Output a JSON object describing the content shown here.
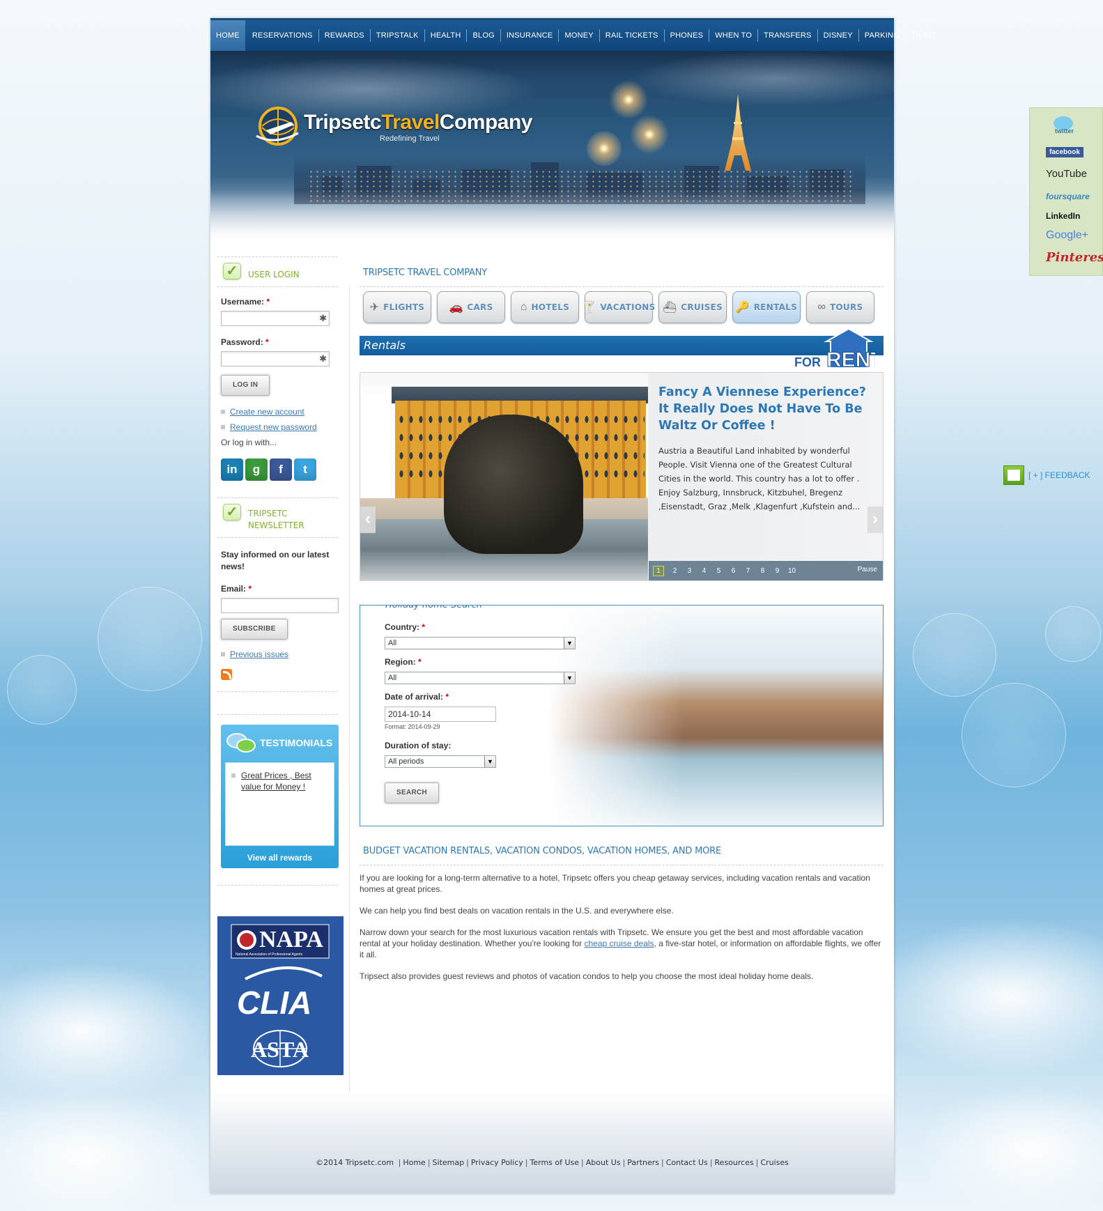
{
  "nav": {
    "items": [
      "HOME",
      "RESERVATIONS",
      "REWARDS",
      "TRIPSTALK",
      "HEALTH",
      "BLOG",
      "INSURANCE",
      "MONEY",
      "RAIL TICKETS",
      "PHONES",
      "WHEN TO",
      "TRANSFERS",
      "DISNEY",
      "PARKING",
      "TICKIT"
    ],
    "active": "HOME"
  },
  "header": {
    "logo_main": "Tripsetc",
    "logo_travel": "Travel",
    "logo_company": "Company",
    "tagline": "Redefining Travel"
  },
  "login": {
    "title": "USER LOGIN",
    "username_label": "Username:",
    "password_label": "Password:",
    "required_mark": "*",
    "login_button": "LOG IN",
    "create_account": "Create new account",
    "request_password": "Request new password",
    "or_login": "Or log in with..."
  },
  "social_login": [
    {
      "name": "linkedin",
      "label": "in",
      "color": "#1b80b5"
    },
    {
      "name": "google",
      "label": "g",
      "color": "#3b9a3c"
    },
    {
      "name": "facebook",
      "label": "f",
      "color": "#3b5998"
    },
    {
      "name": "twitter",
      "label": "t",
      "color": "#3aa5df"
    }
  ],
  "newsletter": {
    "title_line1": "TRIPSETC",
    "title_line2": "NEWSLETTER",
    "lead": "Stay informed on our latest news!",
    "email_label": "Email:",
    "subscribe_button": "SUBSCRIBE",
    "previous_issues": "Previous issues"
  },
  "testimonials": {
    "title": "TESTIMONIALS",
    "item": "Great Prices , Best value for Money !",
    "view_all": "View all rewards"
  },
  "associations": [
    "NAPA",
    "National Association of Professional Agents",
    "CLIA",
    "ASTA"
  ],
  "main": {
    "title": "TRIPSETC TRAVEL COMPANY",
    "tabs": [
      {
        "label": "FLIGHTS",
        "icon": "airplane-icon",
        "glyph": "✈"
      },
      {
        "label": "CARS",
        "icon": "car-icon",
        "glyph": "🚗"
      },
      {
        "label": "HOTELS",
        "icon": "house-icon",
        "glyph": "⌂"
      },
      {
        "label": "VACATIONS",
        "icon": "cocktail-icon",
        "glyph": "🍸"
      },
      {
        "label": "CRUISES",
        "icon": "ship-icon",
        "glyph": "⛴"
      },
      {
        "label": "RENTALS",
        "icon": "key-icon",
        "glyph": "🔑"
      },
      {
        "label": "TOURS",
        "icon": "binoculars-icon",
        "glyph": "∞"
      }
    ],
    "active_tab": "RENTALS",
    "section_label": "Rentals",
    "forrent_for": "FOR",
    "forrent_rent": "RENT"
  },
  "slider": {
    "headline": "Fancy A Viennese Experience? It Really Does Not Have To Be Waltz Or Coffee !",
    "body": "Austria a Beautiful Land inhabited by wonderful People. Visit Vienna one of the Greatest Cultural Cities in the world. This country has a lot to offer . Enjoy Salzburg, Innsbruck, Kitzbuhel, Bregenz ,Eisenstadt, Graz ,Melk ,Klagenfurt ,Kufstein and...",
    "pages": [
      "1",
      "2",
      "3",
      "4",
      "5",
      "6",
      "7",
      "8",
      "9",
      "10"
    ],
    "current_page": "1",
    "pause": "Pause"
  },
  "holiday_search": {
    "legend": "Holiday home Search",
    "country_label": "Country:",
    "country_value": "All",
    "region_label": "Region:",
    "region_value": "All",
    "arrival_label": "Date of arrival:",
    "arrival_value": "2014-10-14",
    "arrival_hint": "Format: 2014-09-29",
    "duration_label": "Duration of stay:",
    "duration_value": "All periods",
    "search_button": "SEARCH"
  },
  "description": {
    "title": "BUDGET VACATION RENTALS, VACATION CONDOS, VACATION HOMES, AND MORE",
    "p1": "If you are looking for a long-term alternative to a hotel, Tripsetc offers you cheap getaway services, including vacation rentals and vacation homes at great prices.",
    "p2": "We can help you find best deals on vacation rentals in the U.S. and everywhere else.",
    "p3_before": "Narrow down your search for the most luxurious vacation rentals with Tripsetc. We ensure you get the best and most affordable vacation rental at your holiday destination. Whether you're looking for ",
    "p3_link": "cheap cruise deals",
    "p3_after": ", a five-star hotel, or information on affordable flights, we offer it all.",
    "p4": "Tripsect also provides guest reviews and photos of vacation condos to help you choose the most ideal holiday home deals."
  },
  "social_bar": [
    "twitter",
    "facebook",
    "YouTube",
    "foursquare",
    "LinkedIn",
    "Google+",
    "Pinterest"
  ],
  "feedback": "[ + ] FEEDBACK",
  "footer": {
    "copyright": "©2014 Tripsetc.com",
    "links": [
      "Home",
      "Sitemap",
      "Privacy Policy",
      "Terms of Use",
      "About Us",
      "Partners",
      "Contact Us",
      "Resources",
      "Cruises"
    ]
  },
  "colors": {
    "nav_blue": "#0f4479",
    "accent_blue": "#2e78b2",
    "green": "#82b22c",
    "gold": "#f2b21f"
  }
}
